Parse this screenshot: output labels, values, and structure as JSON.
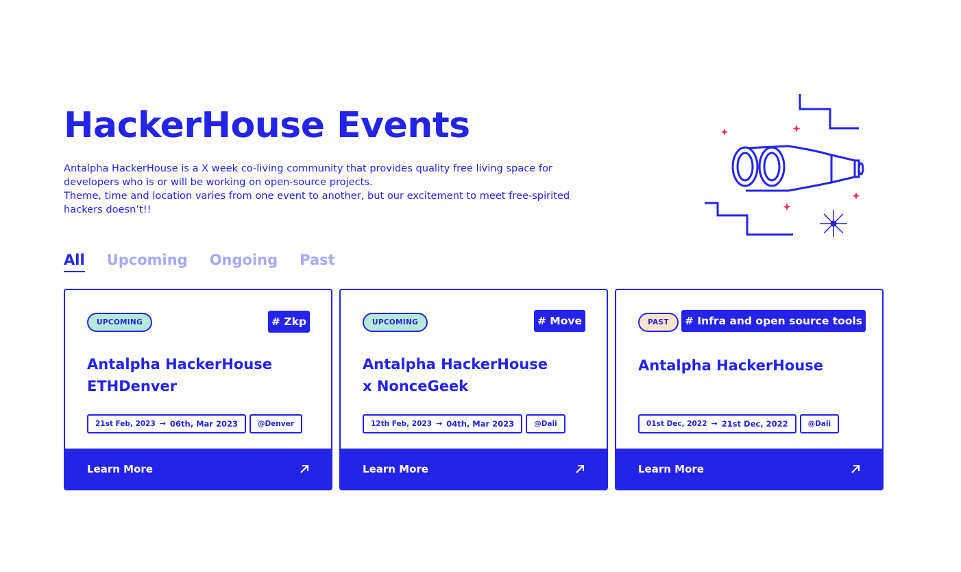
{
  "header": {
    "title": "HackerHouse Events",
    "description_lines": [
      "Antalpha HackerHouse is a X week co-living community that provides quality free living space for",
      "developers who is or will be working on open-source projects.",
      "Theme, time and location varies from one event to another, but our excitement to meet free-spirited",
      "hackers doesn’t!!"
    ],
    "illustration_icon": "binoculars-icon"
  },
  "tabs": [
    {
      "label": "All",
      "active": true
    },
    {
      "label": "Upcoming",
      "active": false
    },
    {
      "label": "Ongoing",
      "active": false
    },
    {
      "label": "Past",
      "active": false
    }
  ],
  "events": [
    {
      "status": "UPCOMING",
      "tag": "# Zkp",
      "title_lines": [
        "Antalpha HackerHouse",
        "ETHDenver"
      ],
      "start": "21st Feb, 2023",
      "end": "06th, Mar 2023",
      "location": "@Denver",
      "cta": "Learn More"
    },
    {
      "status": "UPCOMING",
      "tag": "# Move",
      "title_lines": [
        "Antalpha HackerHouse",
        "x NonceGeek"
      ],
      "start": "12th Feb, 2023",
      "end": "04th, Mar 2023",
      "location": "@Dali",
      "cta": "Learn More"
    },
    {
      "status": "PAST",
      "tag": "# Infra and open source tools",
      "title_lines": [
        "Antalpha HackerHouse",
        ""
      ],
      "start": "01st Dec, 2022",
      "end": "21st Dec, 2022",
      "location": "@Dali",
      "cta": "Learn More"
    }
  ],
  "colors": {
    "primary": "#2424e8",
    "tab_inactive": "#a7a9f5",
    "upcoming_badge": "#b5ead9",
    "past_badge": "#fde4cc",
    "sparkle": "#e8315c"
  }
}
